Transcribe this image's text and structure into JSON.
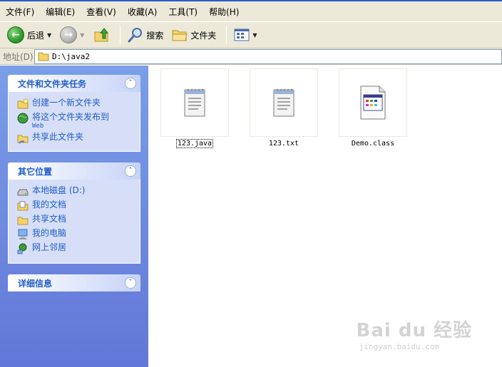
{
  "menubar": {
    "items": [
      "文件(F)",
      "编辑(E)",
      "查看(V)",
      "收藏(A)",
      "工具(T)",
      "帮助(H)"
    ]
  },
  "toolbar": {
    "back_label": "后退",
    "search_label": "搜索",
    "folders_label": "文件夹"
  },
  "address": {
    "label": "地址(D)",
    "value": "D:\\java2"
  },
  "taskpane": {
    "file_tasks": {
      "title": "文件和文件夹任务",
      "items": [
        {
          "label": "创建一个新文件夹"
        },
        {
          "label": "将这个文件夹发布到",
          "sub": "Web"
        },
        {
          "label": "共享此文件夹"
        }
      ]
    },
    "other_places": {
      "title": "其它位置",
      "items": [
        {
          "label": "本地磁盘 (D:)"
        },
        {
          "label": "我的文档"
        },
        {
          "label": "共享文档"
        },
        {
          "label": "我的电脑"
        },
        {
          "label": "网上邻居"
        }
      ]
    },
    "details": {
      "title": "详细信息"
    }
  },
  "files": [
    {
      "name": "123.java",
      "icon": "text-file-icon"
    },
    {
      "name": "123.txt",
      "icon": "text-file-icon"
    },
    {
      "name": "Demo.class",
      "icon": "class-file-icon"
    }
  ],
  "watermark": {
    "logo": "Bai du 经验",
    "url": "jingyan.baidu.com"
  },
  "colors": {
    "taskpane_top": "#7b9ee8",
    "taskpane_bottom": "#6277d7",
    "panel_title": "#215dc6",
    "toolbar_bg": "#ece9d8"
  }
}
